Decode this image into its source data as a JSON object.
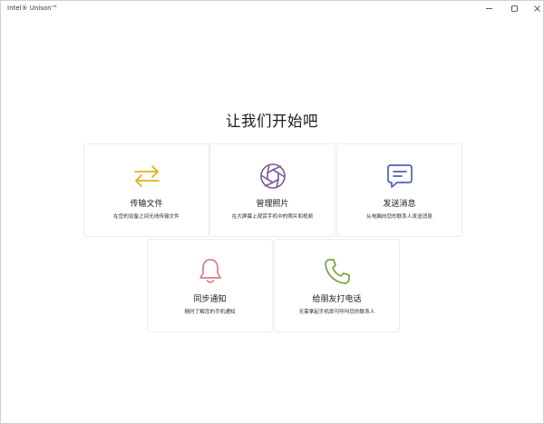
{
  "window": {
    "title": "Intel® Unison™"
  },
  "main": {
    "heading": "让我们开始吧",
    "cards": [
      {
        "title": "传输文件",
        "description": "在您的设备之间无线传输文件",
        "icon": "transfer-arrows-icon",
        "color": "#e0b21d"
      },
      {
        "title": "管理照片",
        "description": "在大屏幕上观赏手机中的照片和视频",
        "icon": "camera-aperture-icon",
        "color": "#7c5a92"
      },
      {
        "title": "发送消息",
        "description": "从电脑向您的联系人发送消息",
        "icon": "message-bubble-icon",
        "color": "#4b5fc4"
      },
      {
        "title": "同步通知",
        "description": "随时了解您的手机通知",
        "icon": "bell-icon",
        "color": "#e07b84"
      },
      {
        "title": "给朋友打电话",
        "description": "无需拿起手机即可呼叫您的联系人",
        "icon": "phone-icon",
        "color": "#7ea13c"
      }
    ]
  }
}
